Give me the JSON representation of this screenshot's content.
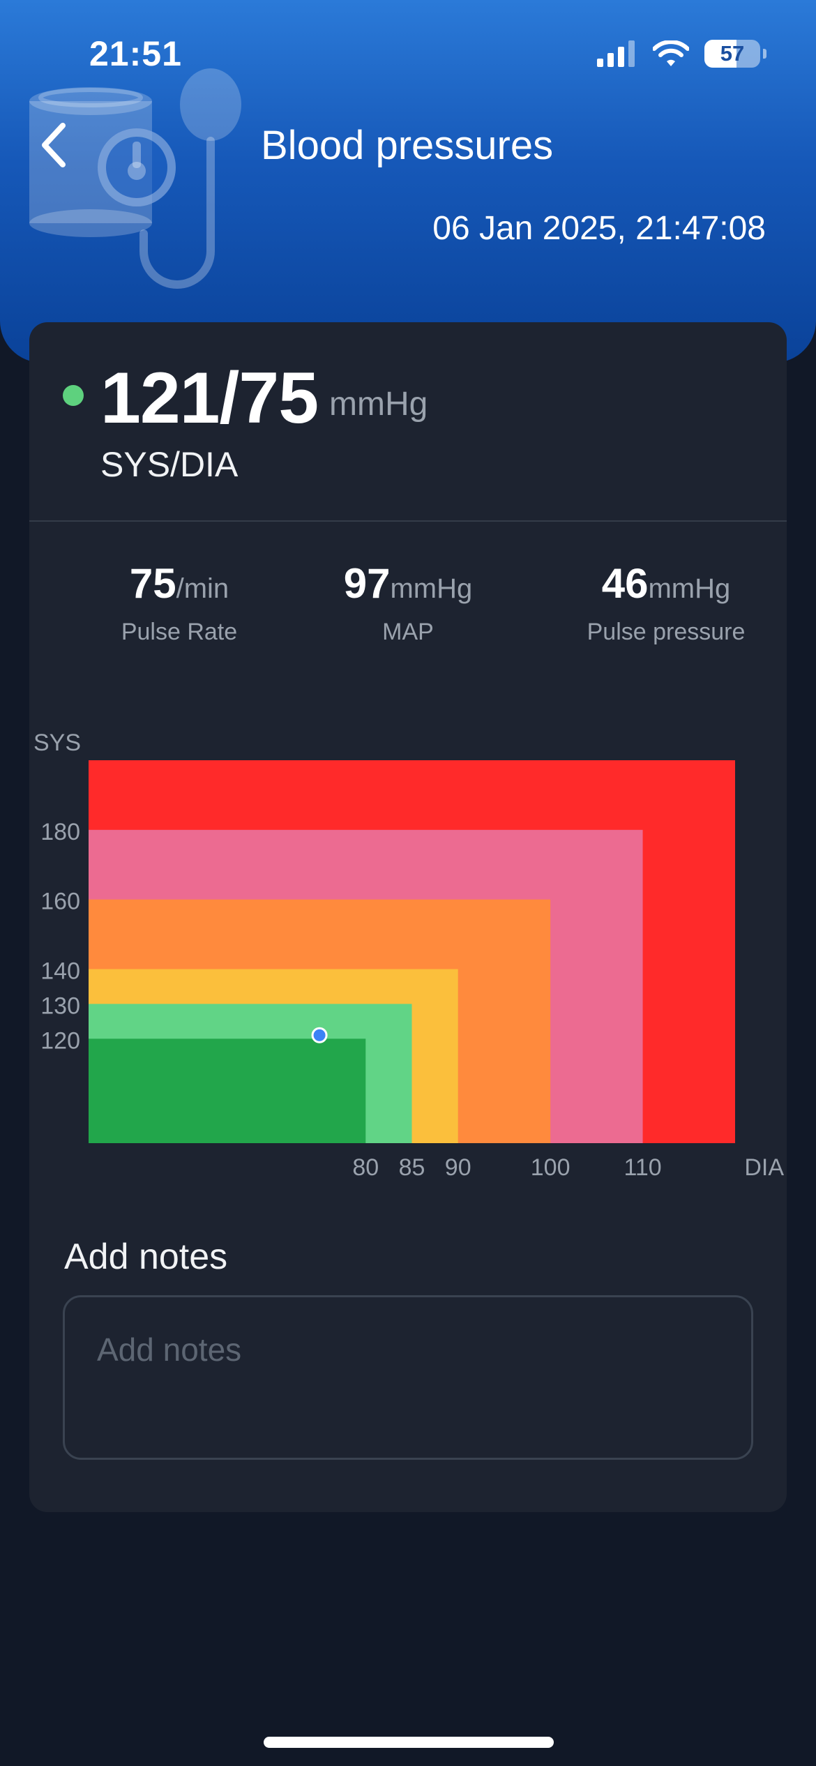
{
  "status_bar": {
    "time": "21:51",
    "battery": "57",
    "battery_level": 0.57
  },
  "header": {
    "title": "Blood pressures",
    "timestamp": "06 Jan 2025, 21:47:08",
    "back_icon": "chevron-left-icon",
    "illustration": "blood-pressure-monitor-icon",
    "gradient": [
      "#2b7ad8",
      "#0a4299"
    ]
  },
  "reading": {
    "value": "121/75",
    "unit": "mmHg",
    "label": "SYS/DIA",
    "status_color": "#5ed17e"
  },
  "metrics": [
    {
      "value": "75",
      "unit": "/min",
      "label": "Pulse Rate"
    },
    {
      "value": "97",
      "unit": "mmHg",
      "label": "MAP"
    },
    {
      "value": "46",
      "unit": "mmHg",
      "label": "Pulse pressure"
    }
  ],
  "chart_data": {
    "type": "area",
    "xlabel": "DIA",
    "ylabel": "SYS",
    "x_ticks": [
      80,
      85,
      90,
      100,
      110
    ],
    "y_ticks": [
      120,
      130,
      140,
      160,
      180
    ],
    "xlim": [
      50,
      120
    ],
    "ylim": [
      90,
      200
    ],
    "zones": [
      {
        "dia_max": 120,
        "sys_max": 200,
        "color": "#ff2a2a"
      },
      {
        "dia_max": 110,
        "sys_max": 180,
        "color": "#ec6b91"
      },
      {
        "dia_max": 100,
        "sys_max": 160,
        "color": "#ff8a3d"
      },
      {
        "dia_max": 90,
        "sys_max": 140,
        "color": "#fbbf3c"
      },
      {
        "dia_max": 85,
        "sys_max": 130,
        "color": "#61d486"
      },
      {
        "dia_max": 80,
        "sys_max": 120,
        "color": "#22a64b"
      }
    ],
    "point": {
      "dia": 75,
      "sys": 121,
      "color": "#3b82f6"
    }
  },
  "notes": {
    "title": "Add notes",
    "placeholder": "Add notes"
  }
}
